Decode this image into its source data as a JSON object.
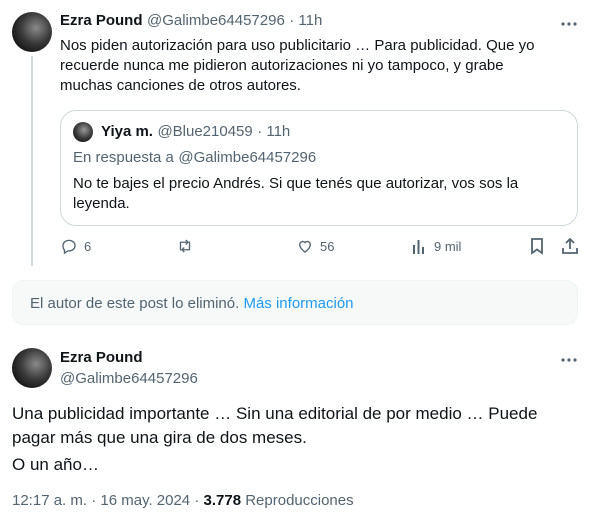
{
  "reply_tweet": {
    "author_name": "Ezra Pound",
    "author_handle": "@Galimbe64457296",
    "time": "· 11h",
    "text": "Nos piden autorización para uso publicitario … Para publicidad. Que yo recuerde nunca me pidieron autorizaciones ni yo tampoco, y grabe muchas canciones de otros autores.",
    "quoted": {
      "author_name": "Yiya m.",
      "author_handle": "@Blue210459",
      "time": "· 11h",
      "in_reply_prefix": "En respuesta a",
      "in_reply_handle": "@Galimbe64457296",
      "text": "No te bajes el precio Andrés. Si que tenés que autorizar, vos sos la leyenda."
    },
    "actions": {
      "replies": "6",
      "likes": "56",
      "views": "9 mil"
    }
  },
  "deleted_notice": {
    "text": "El autor de este post lo eliminó.",
    "link": "Más información"
  },
  "main_tweet": {
    "author_name": "Ezra Pound",
    "author_handle": "@Galimbe64457296",
    "text_line1": "Una publicidad importante … Sin una editorial de por medio … Puede",
    "text_line2": "pagar más que una gira de dos meses.",
    "text_line3": "O un año…",
    "timestamp": "12:17 a. m. · 16 may. 2024 ·",
    "views_count": "3.778",
    "views_label": "Reproducciones"
  },
  "colors": {
    "accent": "#1d9bf0",
    "muted": "#536471",
    "border": "#cfd9de"
  }
}
